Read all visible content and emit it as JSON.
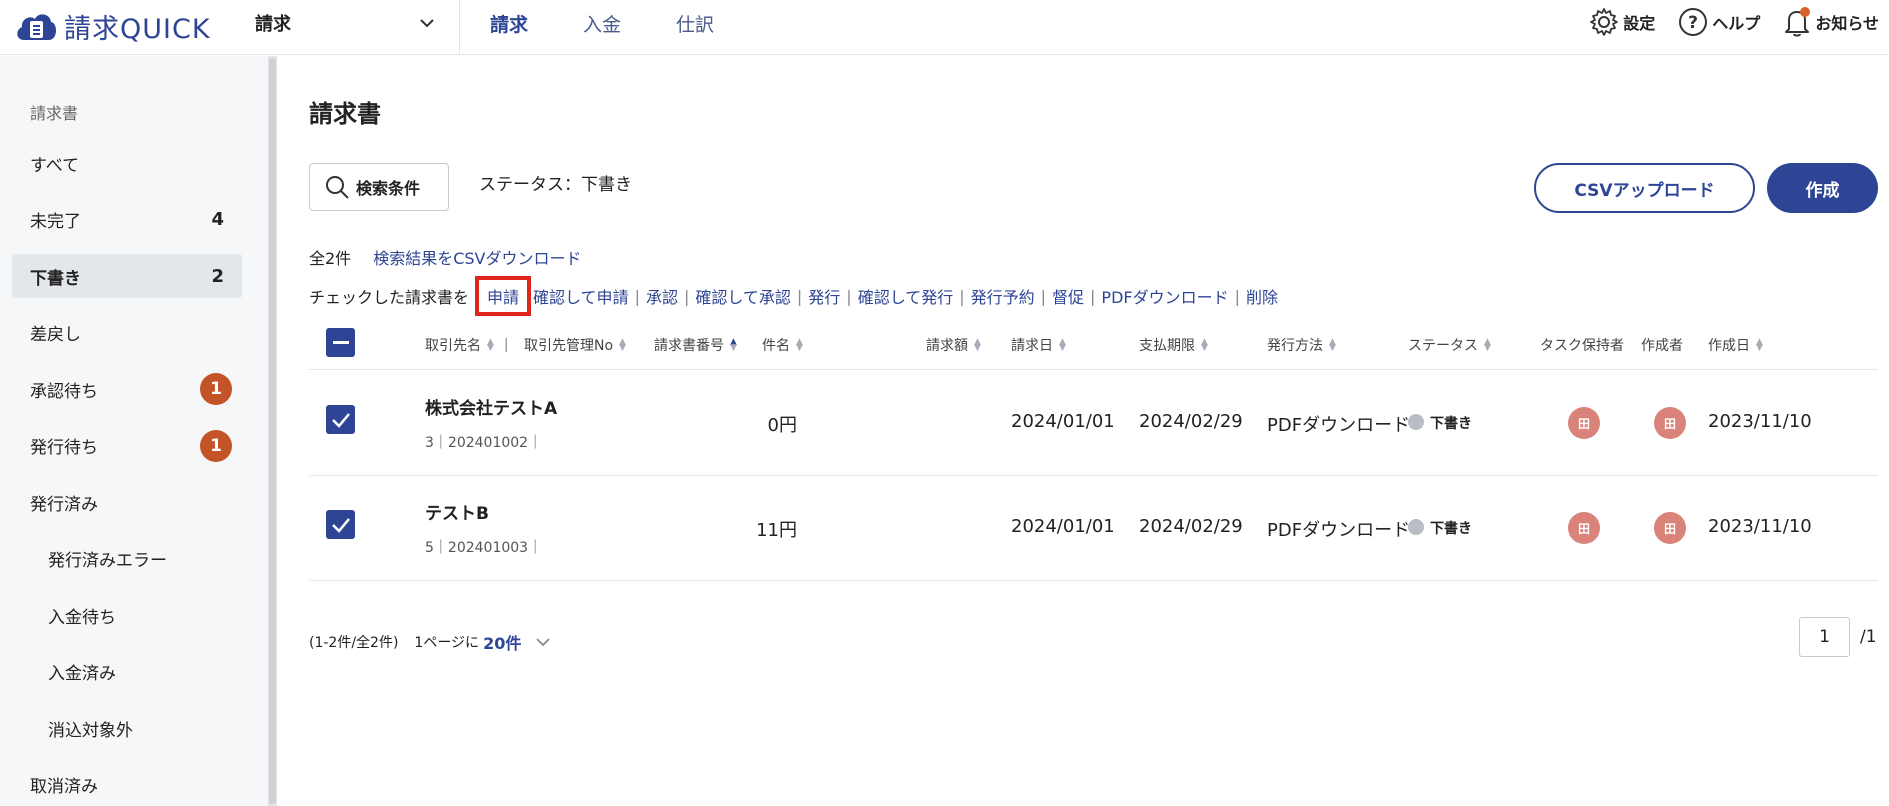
{
  "header": {
    "logo_text": "請求QUICK",
    "app_selector": "請求",
    "nav": [
      "請求",
      "入金",
      "仕訳"
    ],
    "settings": "設定",
    "help": "ヘルプ",
    "notifications": "お知らせ"
  },
  "sidebar": {
    "heading": "請求書",
    "items": [
      {
        "label": "すべて",
        "count": ""
      },
      {
        "label": "未完了",
        "count": "4"
      },
      {
        "label": "下書き",
        "count": "2"
      },
      {
        "label": "差戻し",
        "count": ""
      },
      {
        "label": "承認待ち",
        "badge": "1"
      },
      {
        "label": "発行待ち",
        "badge": "1"
      },
      {
        "label": "発行済み",
        "count": ""
      },
      {
        "label": "発行済みエラー",
        "count": ""
      },
      {
        "label": "入金待ち",
        "count": ""
      },
      {
        "label": "入金済み",
        "count": ""
      },
      {
        "label": "消込対象外",
        "count": ""
      },
      {
        "label": "取消済み",
        "count": ""
      }
    ]
  },
  "main": {
    "title": "請求書",
    "search_button": "検索条件",
    "status_label": "ステータス：下書き",
    "csv_upload": "CSVアップロード",
    "create": "作成",
    "total": "全2件",
    "csv_download": "検索結果をCSVダウンロード",
    "action_prefix": "チェックした請求書を",
    "actions": [
      "申請",
      "確認して申請",
      "承認",
      "確認して承認",
      "発行",
      "確認して発行",
      "発行予約",
      "督促",
      "PDFダウンロード",
      "削除"
    ]
  },
  "table": {
    "columns": [
      "取引先名",
      "取引先管理No",
      "請求書番号",
      "件名",
      "請求額",
      "請求日",
      "支払期限",
      "発行方法",
      "ステータス",
      "タスク保持者",
      "作成者",
      "作成日"
    ],
    "rows": [
      {
        "partner": "株式会社テストA",
        "sub": "3｜202401002｜",
        "amount": "0円",
        "invoice_date": "2024/01/01",
        "due_date": "2024/02/29",
        "method": "PDFダウンロード",
        "status": "下書き",
        "task_holder": "田",
        "creator": "田",
        "created": "2023/11/10"
      },
      {
        "partner": "テストB",
        "sub": "5｜202401003｜",
        "amount": "11円",
        "invoice_date": "2024/01/01",
        "due_date": "2024/02/29",
        "method": "PDFダウンロード",
        "status": "下書き",
        "task_holder": "田",
        "creator": "田",
        "created": "2023/11/10"
      }
    ]
  },
  "footer": {
    "range": "(1-2件/全2件)",
    "per_page_label": "1ページに",
    "per_page": "20件",
    "page": "1",
    "page_total": "/1"
  },
  "colors": {
    "accent": "#2e4596",
    "badge": "#c25427",
    "highlight": "#e0251b",
    "avatar": "#d9837a"
  }
}
